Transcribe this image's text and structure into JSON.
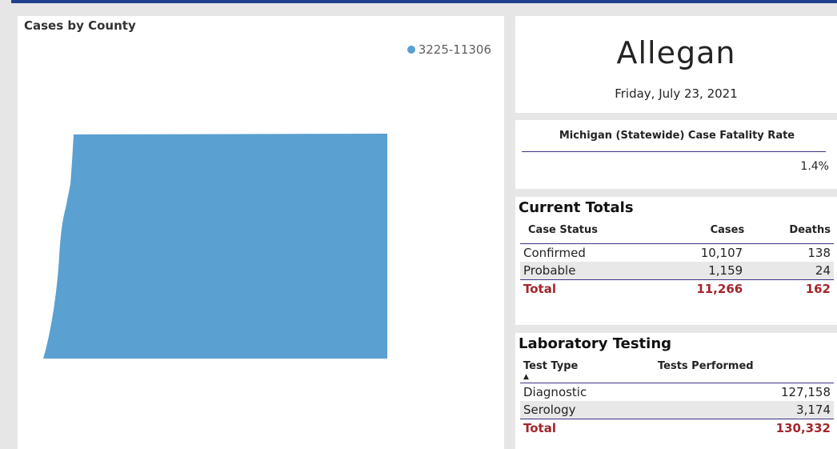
{
  "map": {
    "title": "Cases by County",
    "legend_label": "3225-11306",
    "fill_color": "#5aa0d0"
  },
  "county": {
    "name": "Allegan",
    "date": "Friday, July 23, 2021"
  },
  "fatality": {
    "header": "Michigan (Statewide) Case Fatality Rate",
    "value": "1.4%"
  },
  "totals": {
    "title": "Current Totals",
    "columns": [
      "Case Status",
      "Cases",
      "Deaths"
    ],
    "rows": [
      [
        "Confirmed",
        "10,107",
        "138"
      ],
      [
        "Probable",
        "1,159",
        "24"
      ]
    ],
    "total": [
      "Total",
      "11,266",
      "162"
    ]
  },
  "lab": {
    "title": "Laboratory Testing",
    "columns": [
      "Test Type",
      "Tests Performed"
    ],
    "sort_icon": "sort-ascending-icon",
    "rows": [
      [
        "Diagnostic",
        "127,158"
      ],
      [
        "Serology",
        "3,174"
      ]
    ],
    "total": [
      "Total",
      "130,332"
    ]
  },
  "colors": {
    "accent_bar": "#1f3f8f",
    "total_text": "#a4262c",
    "divider": "#3b3486"
  }
}
